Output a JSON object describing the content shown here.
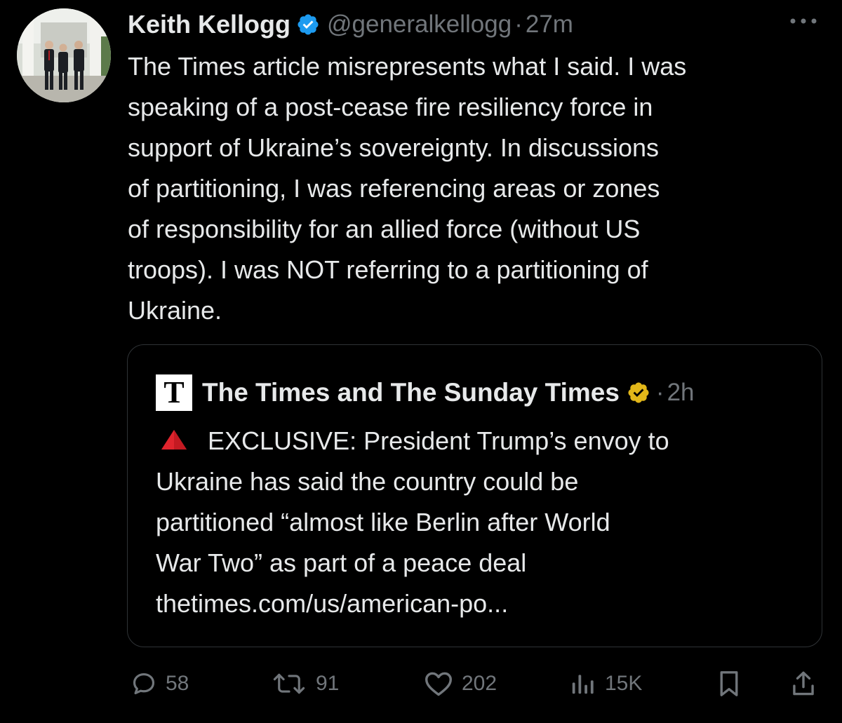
{
  "tweet": {
    "author_name": "Keith Kellogg",
    "handle": "@generalkellogg",
    "separator": "·",
    "time": "27m",
    "verified_icon": "blue-verified-badge",
    "more_icon": "more-horizontal-icon",
    "text_lines": [
      "The Times article misrepresents what I said. I was",
      "speaking of a post-cease fire resiliency force in",
      "support of Ukraine’s sovereignty. In discussions",
      "of partitioning, I was referencing areas or zones",
      "of responsibility for an allied force (without US",
      "troops). I was NOT referring to a partitioning of",
      "Ukraine."
    ]
  },
  "quote": {
    "logo_letter": "T",
    "author_name": "The Times and The Sunday Times",
    "verified_icon": "gold-verified-badge",
    "separator": "·",
    "time": "2h",
    "lead_icon": "red-triangle-icon",
    "text_lines": [
      "EXCLUSIVE: President Trump’s envoy to",
      "Ukraine has said the country could be",
      "partitioned “almost like Berlin after World",
      "War Two” as part of a peace deal",
      "thetimes.com/us/american-po..."
    ]
  },
  "actions": {
    "replies": "58",
    "reposts": "91",
    "likes": "202",
    "views": "15K"
  },
  "colors": {
    "background": "#000000",
    "text": "#e7e9ea",
    "secondary": "#71767b",
    "border": "#2f3336",
    "verified_blue": "#1d9bf0",
    "verified_gold": "#e2b719",
    "alert_red": "#e0242d"
  }
}
